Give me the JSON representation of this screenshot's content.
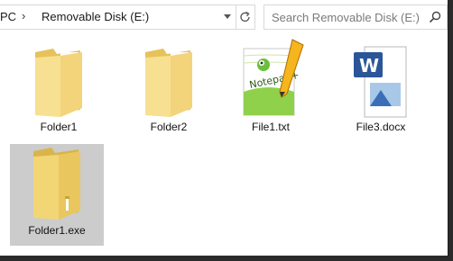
{
  "address": {
    "this_pc": "PC",
    "drive": "Removable Disk (E:)"
  },
  "search": {
    "placeholder": "Search Removable Disk (E:)"
  },
  "items": [
    {
      "name": "Folder1",
      "type": "folder",
      "selected": false
    },
    {
      "name": "Folder2",
      "type": "folder",
      "selected": false
    },
    {
      "name": "File1.txt",
      "type": "notepad-plus-file",
      "selected": false
    },
    {
      "name": "File3.docx",
      "type": "word-document",
      "selected": false
    },
    {
      "name": "Folder1.exe",
      "type": "folder-exe",
      "selected": true
    }
  ],
  "colors": {
    "selection": "#cccccc",
    "folder_yellow": "#f6d979",
    "word_blue": "#2a5699"
  }
}
